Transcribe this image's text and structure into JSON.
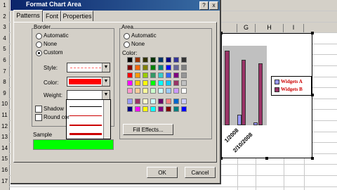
{
  "dialog": {
    "title": "Format Chart Area",
    "help_btn": "?",
    "close_btn": "x",
    "tabs": [
      "Patterns",
      "Font",
      "Properties"
    ],
    "border": {
      "group_label": "Border",
      "automatic": "Automatic",
      "none": "None",
      "custom": "Custom",
      "style_label": "Style:",
      "color_label": "Color:",
      "weight_label": "Weight:",
      "shadow": "Shadow",
      "round_corners": "Round cor"
    },
    "area": {
      "group_label": "Area",
      "automatic": "Automatic",
      "none": "None",
      "color_label": "Color:",
      "fill_effects": "Fill Effects..."
    },
    "sample_label": "Sample",
    "ok": "OK",
    "cancel": "Cancel"
  },
  "sheet": {
    "columns": [
      "G",
      "H",
      "I"
    ],
    "rows": [
      "1",
      "2",
      "3",
      "4",
      "5",
      "6",
      "7",
      "8",
      "9",
      "10",
      "11",
      "12",
      "13",
      "14",
      "15",
      "16",
      "17"
    ]
  },
  "chart_data": {
    "type": "bar",
    "categories": [
      "1/2008",
      "2/10/2008"
    ],
    "series": [
      {
        "name": "Widgets A",
        "color": "#9999ff",
        "values": [
          15,
          4
        ]
      },
      {
        "name": "Widgets B",
        "color": "#993366",
        "values": [
          100,
          95
        ]
      }
    ],
    "colors": {
      "first_bar": "#993366"
    }
  },
  "palette": [
    "#000000",
    "#993300",
    "#333300",
    "#003300",
    "#003366",
    "#000080",
    "#333399",
    "#333333",
    "#800000",
    "#ff6600",
    "#808000",
    "#008000",
    "#008080",
    "#0000ff",
    "#666699",
    "#808080",
    "#ff0000",
    "#ff9900",
    "#99cc00",
    "#339966",
    "#33cccc",
    "#3366ff",
    "#800080",
    "#969696",
    "#ff00ff",
    "#ffcc00",
    "#ffff00",
    "#00ff00",
    "#00ffff",
    "#00ccff",
    "#993366",
    "#c0c0c0",
    "#ff99cc",
    "#ffcc99",
    "#ffff99",
    "#ccffcc",
    "#ccffff",
    "#99ccff",
    "#cc99ff",
    "#ffffff",
    "#9999ff",
    "#993366",
    "#ffffcc",
    "#ccffff",
    "#660066",
    "#ff8080",
    "#0066cc",
    "#ccccff",
    "#000080",
    "#ff00ff",
    "#ffff00",
    "#00ffff",
    "#800080",
    "#800000",
    "#008080",
    "#0000ff"
  ]
}
